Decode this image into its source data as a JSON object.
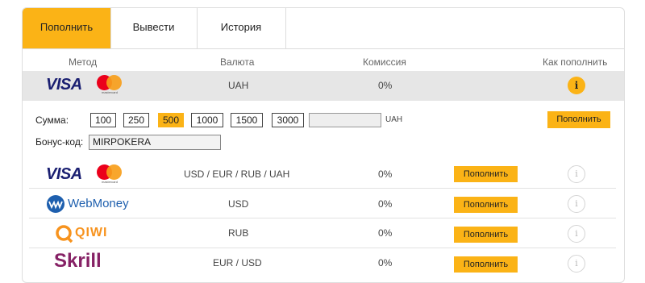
{
  "tabs": [
    {
      "label": "Пополнить",
      "active": true
    },
    {
      "label": "Вывести",
      "active": false
    },
    {
      "label": "История",
      "active": false
    }
  ],
  "headers": {
    "method": "Метод",
    "currency": "Валюта",
    "commission": "Комиссия",
    "how": "Как пополнить"
  },
  "selected_method": {
    "logos": [
      "VISA",
      "mastercard"
    ],
    "currency": "UAH",
    "commission": "0%",
    "info_icon": "info-icon"
  },
  "deposit_form": {
    "amount_label": "Сумма:",
    "amounts": [
      "100",
      "250",
      "500",
      "1000",
      "1500",
      "3000"
    ],
    "selected_amount": "500",
    "amount_value": "",
    "currency": "UAH",
    "submit_label": "Пополнить",
    "bonus_label": "Бонус-код:",
    "bonus_value": "MIRPOKERA"
  },
  "methods": [
    {
      "logo": "VISA / mastercard",
      "currency": "USD / EUR / RUB / UAH",
      "commission": "0%",
      "button": "Пополнить"
    },
    {
      "logo": "WebMoney",
      "currency": "USD",
      "commission": "0%",
      "button": "Пополнить"
    },
    {
      "logo": "QIWI",
      "currency": "RUB",
      "commission": "0%",
      "button": "Пополнить"
    },
    {
      "logo": "Skrill",
      "currency": "EUR / USD",
      "commission": "0%",
      "button": "Пополнить"
    }
  ],
  "colors": {
    "accent": "#fbb316",
    "visa_blue": "#1a1f71",
    "webmoney_blue": "#1e5fae",
    "qiwi_orange": "#f7931e",
    "skrill_purple": "#862165"
  }
}
